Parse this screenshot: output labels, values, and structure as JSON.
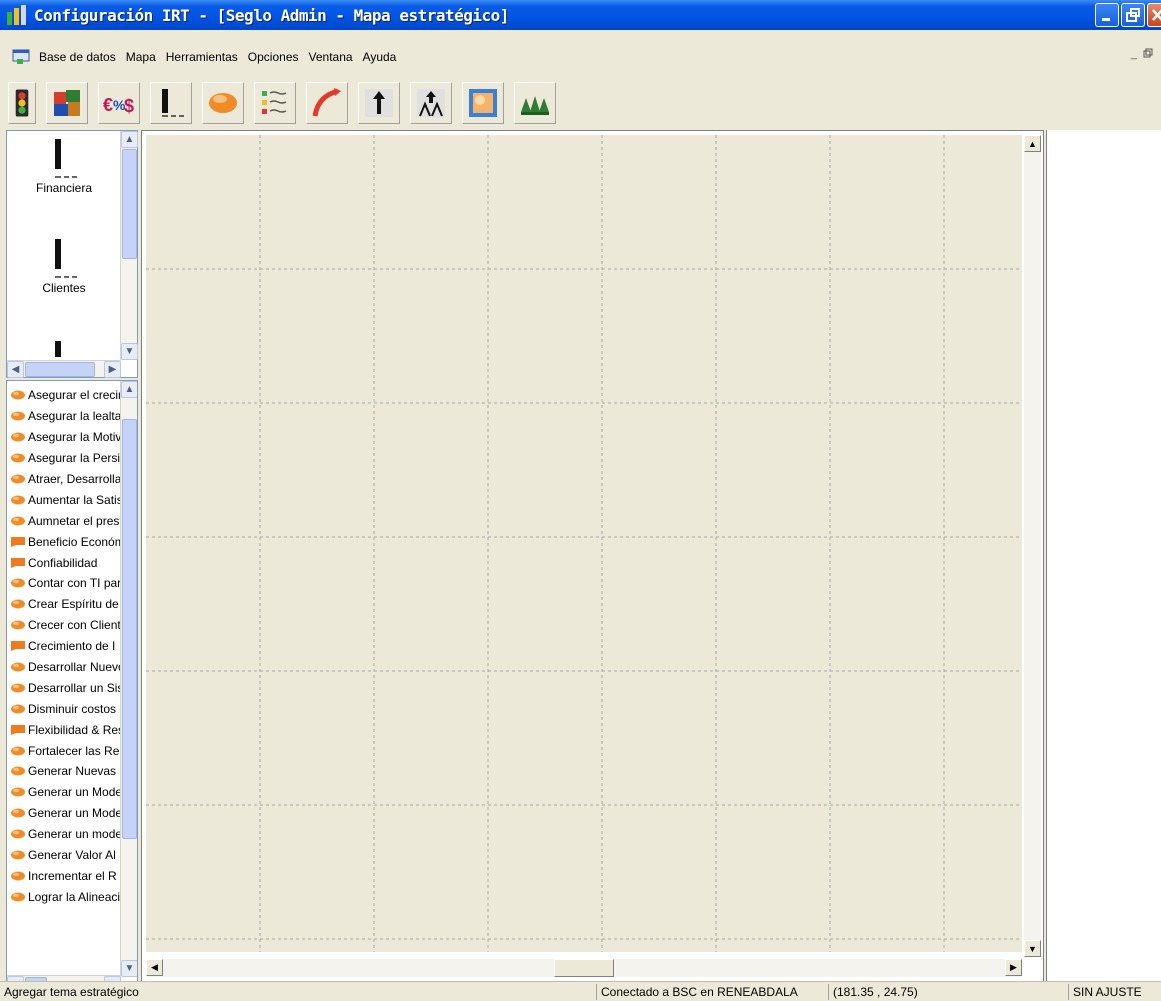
{
  "window": {
    "title": "Configuración IRT - [Seglo Admin - Mapa estratégico]",
    "title_color": "#0054e3"
  },
  "menu": {
    "items": [
      "Base de datos",
      "Mapa",
      "Herramientas",
      "Opciones",
      "Ventana",
      "Ayuda"
    ]
  },
  "toolbar": {
    "buttons": [
      {
        "name": "semaphore-icon"
      },
      {
        "name": "puzzle-icon"
      },
      {
        "name": "percent-currency-icon"
      },
      {
        "name": "perspective-bar-icon"
      },
      {
        "name": "objective-ellipse-icon"
      },
      {
        "name": "list-bullets-icon"
      },
      {
        "name": "curved-arrow-icon"
      },
      {
        "name": "up-arrow-icon"
      },
      {
        "name": "people-up-icon"
      },
      {
        "name": "map-image-icon"
      },
      {
        "name": "forest-icon"
      }
    ]
  },
  "perspectives": {
    "items": [
      {
        "label": "Financiera"
      },
      {
        "label": "Clientes"
      }
    ]
  },
  "objectives": {
    "items": [
      {
        "label": "Asegurar el crecimiento",
        "kind": "ellipse"
      },
      {
        "label": "Asegurar la lealtad",
        "kind": "ellipse"
      },
      {
        "label": "Asegurar la Motivación",
        "kind": "ellipse"
      },
      {
        "label": "Asegurar la Persistencia",
        "kind": "ellipse"
      },
      {
        "label": "Atraer, Desarrollar",
        "kind": "ellipse"
      },
      {
        "label": "Aumentar la Satisfacción",
        "kind": "ellipse"
      },
      {
        "label": " Aumnetar el prestigio",
        "kind": "ellipse"
      },
      {
        "label": "Beneficio Económico",
        "kind": "flag"
      },
      {
        "label": "Confiabilidad",
        "kind": "flag"
      },
      {
        "label": "Contar con TI para",
        "kind": "ellipse"
      },
      {
        "label": "Crear Espíritu de",
        "kind": "ellipse"
      },
      {
        "label": "Crecer con Clientes",
        "kind": "ellipse"
      },
      {
        "label": "Crecimiento de I",
        "kind": "flag"
      },
      {
        "label": "Desarrollar Nuevos",
        "kind": "ellipse"
      },
      {
        "label": "Desarrollar un Sistema",
        "kind": "ellipse"
      },
      {
        "label": "Disminuir costos",
        "kind": "ellipse"
      },
      {
        "label": "Flexibilidad & Respuesta",
        "kind": "flag"
      },
      {
        "label": "Fortalecer las Relaciones",
        "kind": "ellipse"
      },
      {
        "label": "Generar Nuevas",
        "kind": "ellipse"
      },
      {
        "label": "Generar un Modelo",
        "kind": "ellipse"
      },
      {
        "label": "Generar un Modelo",
        "kind": "ellipse"
      },
      {
        "label": "Generar un modelo",
        "kind": "ellipse"
      },
      {
        "label": "Generar Valor Al",
        "kind": "ellipse"
      },
      {
        "label": "Incrementar el R",
        "kind": "ellipse"
      },
      {
        "label": "Lograr la Alineación",
        "kind": "ellipse"
      }
    ]
  },
  "status": {
    "hint": "Agregar tema estratégico",
    "connection": "Conectado a BSC en RENEABDALA",
    "coords": "(181.35 , 24.75)",
    "zoom": "SIN AJUSTE"
  },
  "colors": {
    "ellipse": "#f08c28",
    "flag": "#f07a1e",
    "canvas": "#ece9d8",
    "grid": "#a9a9a9"
  }
}
